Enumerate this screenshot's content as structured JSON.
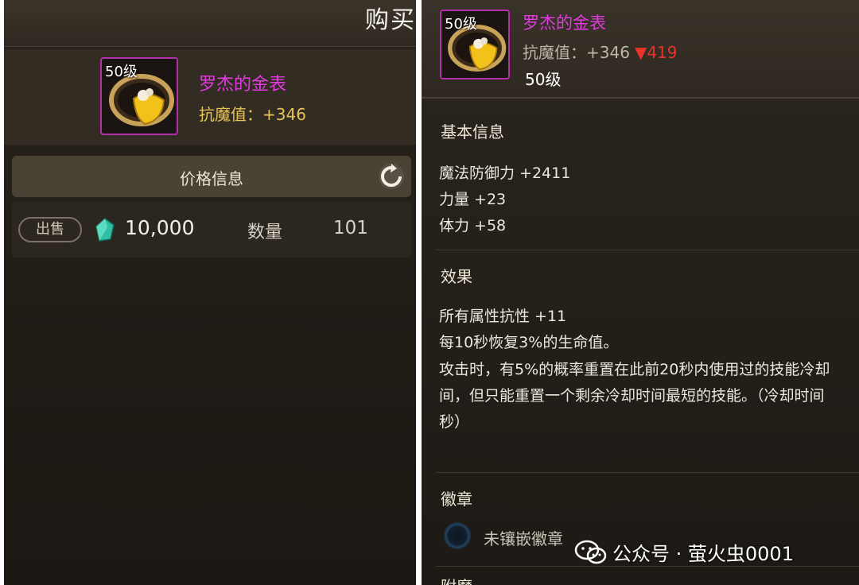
{
  "left": {
    "buy_title": "购买",
    "item": {
      "level": "50级",
      "name": "罗杰的金表",
      "stat": "抗魔值：+346"
    },
    "price_section_title": "价格信息",
    "listing": {
      "sale_button": "出售",
      "price": "10,000",
      "quantity_label": "数量",
      "quantity": "101"
    }
  },
  "right": {
    "item": {
      "level_badge": "50级",
      "name": "罗杰的金表",
      "stat_label": "抗魔值：+346",
      "stat_compare": "▼419",
      "level": "50级"
    },
    "basic_info": {
      "title": "基本信息",
      "lines": [
        "魔法防御力 +2411",
        "力量 +23",
        "体力 +58"
      ]
    },
    "effect": {
      "title": "效果",
      "lines": [
        "所有属性抗性 +11",
        "每10秒恢复3%的生命值。",
        "攻击时，有5%的概率重置在此前20秒内使用过的技能冷却",
        "间，但只能重置一个剩余冷却时间最短的技能。（冷却时间",
        "秒）"
      ]
    },
    "badge": {
      "title": "徽章",
      "status": "未镶嵌徽章"
    },
    "next_section_title": "附魔"
  },
  "watermark": "公众号 · 萤火虫0001",
  "colors": {
    "item_name": "#e23be0",
    "stat_gold": "#e6c45a",
    "down_red": "#e8332b",
    "icon_border": "#b32fae"
  }
}
